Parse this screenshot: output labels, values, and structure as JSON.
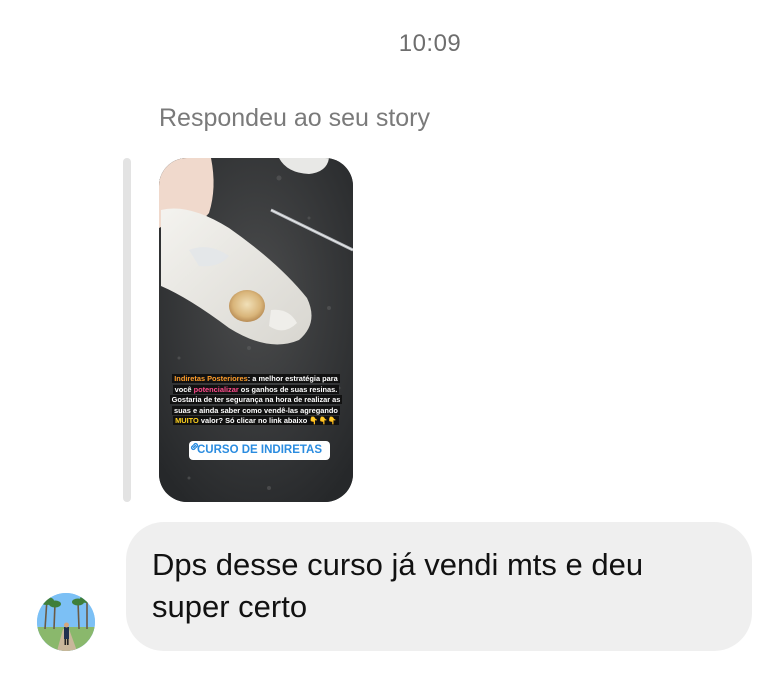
{
  "thread": {
    "timestamp": "10:09",
    "reply_label": "Respondeu ao seu story"
  },
  "story": {
    "caption_lead": "Indiretas Posteriores",
    "caption_1": ": a melhor estratégia para você ",
    "caption_highlight": "potencializar",
    "caption_2": " os ganhos de suas resinas. Gostaria de ter segurança na hora de realizar as suas e ainda saber como vendê-las agregando ",
    "caption_emphasis": "MUITO",
    "caption_3": " valor? Só clicar no link abaixo ",
    "caption_emoji": "👇👇👇",
    "link_icon": "link-icon",
    "link_label": "CURSO DE INDIRETAS"
  },
  "message": {
    "text": "Dps desse curso já vendi mts e deu super certo"
  },
  "colors": {
    "bubble": "#efefef",
    "timestamp": "#6e6e6e",
    "link": "#2a8ce0"
  }
}
